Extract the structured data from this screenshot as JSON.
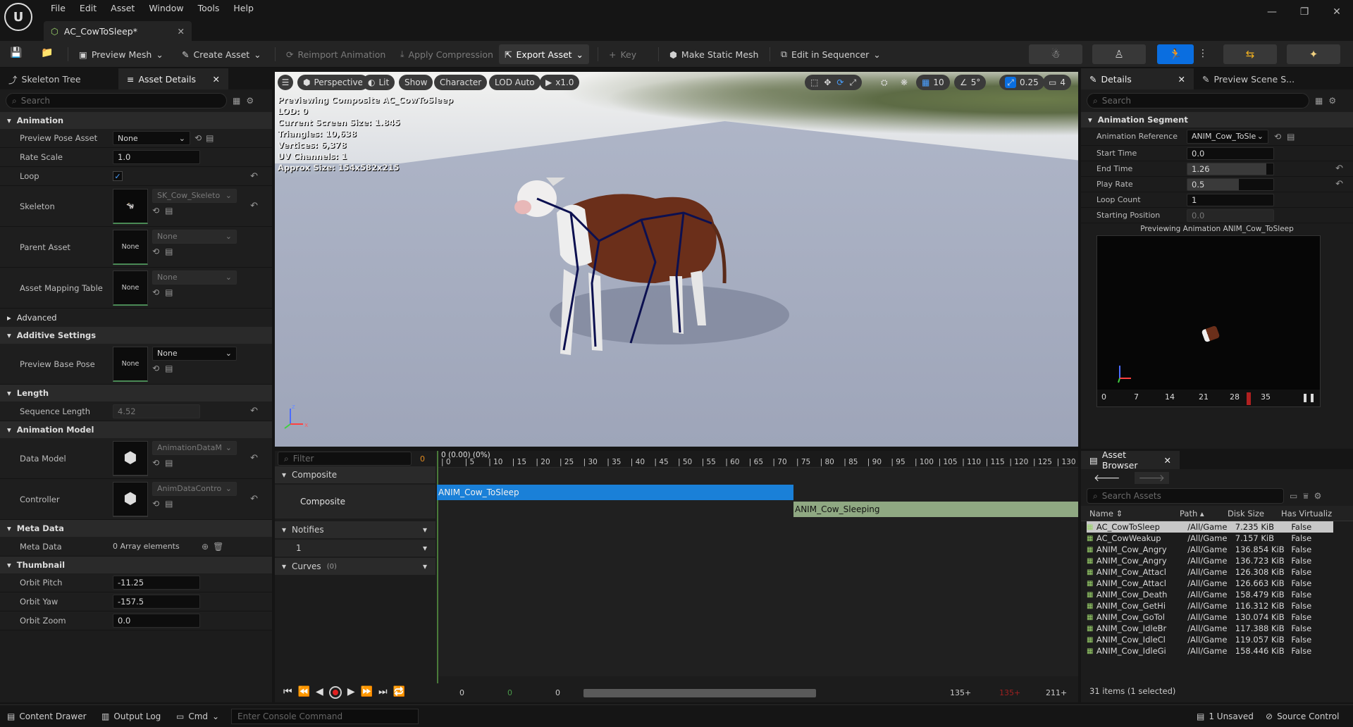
{
  "menu": [
    "File",
    "Edit",
    "Asset",
    "Window",
    "Tools",
    "Help"
  ],
  "doc_tab": {
    "title": "AC_CowToSleep*"
  },
  "toolbar": {
    "preview_mesh": "Preview Mesh",
    "create_asset": "Create Asset",
    "reimport": "Reimport Animation",
    "apply_compression": "Apply Compression",
    "export_asset": "Export Asset",
    "key": "Key",
    "make_static_mesh": "Make Static Mesh",
    "edit_in_sequencer": "Edit in Sequencer"
  },
  "left_tabs": {
    "skeleton_tree": "Skeleton Tree",
    "asset_details": "Asset Details"
  },
  "left_search_placeholder": "Search",
  "sections": {
    "animation": "Animation",
    "advanced": "Advanced",
    "additive": "Additive Settings",
    "length": "Length",
    "anim_model": "Animation Model",
    "meta": "Meta Data",
    "thumbnail": "Thumbnail"
  },
  "props": {
    "preview_pose_asset": {
      "label": "Preview Pose Asset",
      "value": "None"
    },
    "rate_scale": {
      "label": "Rate Scale",
      "value": "1.0"
    },
    "loop": {
      "label": "Loop"
    },
    "skeleton": {
      "label": "Skeleton",
      "value": "SK_Cow_Skeleto"
    },
    "parent_asset": {
      "label": "Parent Asset",
      "value": "None",
      "thumb": "None"
    },
    "asset_mapping": {
      "label": "Asset Mapping Table",
      "value": "None",
      "thumb": "None"
    },
    "preview_base_pose": {
      "label": "Preview Base Pose",
      "value": "None",
      "thumb": "None"
    },
    "sequence_length": {
      "label": "Sequence Length",
      "value": "4.52"
    },
    "data_model": {
      "label": "Data Model",
      "value": "AnimationDataM"
    },
    "controller": {
      "label": "Controller",
      "value": "AnimDataContro"
    },
    "meta_data": {
      "label": "Meta Data",
      "value": "0 Array elements"
    },
    "orbit_pitch": {
      "label": "Orbit Pitch",
      "value": "-11.25"
    },
    "orbit_yaw": {
      "label": "Orbit Yaw",
      "value": "-157.5"
    },
    "orbit_zoom": {
      "label": "Orbit Zoom",
      "value": "0.0"
    }
  },
  "viewport": {
    "perspective": "Perspective",
    "lit": "Lit",
    "show": "Show",
    "character": "Character",
    "lod": "LOD Auto",
    "speed": "x1.0",
    "grid_val": "10",
    "angle_val": "5°",
    "scale_val": "0.25",
    "cam_val": "4",
    "info": [
      "Previewing Composite AC_CowToSleep",
      "LOD: 0",
      "Current Screen Size: 1.845",
      "Triangles: 10,638",
      "Vertices: 6,378",
      "UV Channels: 1",
      "Approx Size: 154x582x215"
    ]
  },
  "timeline": {
    "filter_placeholder": "Filter",
    "frame_counter": "0",
    "head_label": "0 (0.00) (0%)",
    "composite_hdr": "Composite",
    "composite_row": "Composite",
    "notifies": "Notifies",
    "notify_track": "1",
    "curves": "Curves",
    "curves_count": "(0)",
    "segment1": "ANIM_Cow_ToSleep",
    "segment2": "ANIM_Cow_Sleeping",
    "ticks": [
      "0",
      "5",
      "10",
      "15",
      "20",
      "25",
      "30",
      "35",
      "40",
      "45",
      "50",
      "55",
      "60",
      "65",
      "70",
      "75",
      "80",
      "85",
      "90",
      "95",
      "100",
      "105",
      "110",
      "115",
      "120",
      "125",
      "130"
    ],
    "bottom": {
      "a": "0",
      "b": "0",
      "c": "0",
      "end1": "135+",
      "end2": "135+",
      "end3": "211+"
    }
  },
  "details": {
    "tab": "Details",
    "tab2": "Preview Scene S...",
    "search_placeholder": "Search",
    "section": "Animation Segment",
    "anim_ref": {
      "label": "Animation Reference",
      "value": "ANIM_Cow_ToSle"
    },
    "start_time": {
      "label": "Start Time",
      "value": "0.0"
    },
    "end_time": {
      "label": "End Time",
      "value": "1.26"
    },
    "play_rate": {
      "label": "Play Rate",
      "value": "0.5"
    },
    "loop_count": {
      "label": "Loop Count",
      "value": "1"
    },
    "starting_position": {
      "label": "Starting Position",
      "value": "0.0"
    },
    "preview_label": "Previewing Animation ANIM_Cow_ToSleep",
    "mini_ticks": [
      "0",
      "7",
      "14",
      "21",
      "28",
      "35"
    ]
  },
  "asset_browser": {
    "tab": "Asset Browser",
    "search_placeholder": "Search Assets",
    "cols": {
      "name": "Name",
      "path": "Path",
      "size": "Disk Size",
      "virt": "Has Virtualiz"
    },
    "rows": [
      {
        "name": "AC_CowToSleep",
        "path": "/All/Game",
        "size": "7.235 KiB",
        "virt": "False"
      },
      {
        "name": "AC_CowWeakup",
        "path": "/All/Game",
        "size": "7.157 KiB",
        "virt": "False"
      },
      {
        "name": "ANIM_Cow_Angry",
        "path": "/All/Game",
        "size": "136.854 KiB",
        "virt": "False"
      },
      {
        "name": "ANIM_Cow_Angry",
        "path": "/All/Game",
        "size": "136.723 KiB",
        "virt": "False"
      },
      {
        "name": "ANIM_Cow_Attacl",
        "path": "/All/Game",
        "size": "126.308 KiB",
        "virt": "False"
      },
      {
        "name": "ANIM_Cow_Attacl",
        "path": "/All/Game",
        "size": "126.663 KiB",
        "virt": "False"
      },
      {
        "name": "ANIM_Cow_Death",
        "path": "/All/Game",
        "size": "158.479 KiB",
        "virt": "False"
      },
      {
        "name": "ANIM_Cow_GetHi",
        "path": "/All/Game",
        "size": "116.312 KiB",
        "virt": "False"
      },
      {
        "name": "ANIM_Cow_GoTol",
        "path": "/All/Game",
        "size": "130.074 KiB",
        "virt": "False"
      },
      {
        "name": "ANIM_Cow_IdleBr",
        "path": "/All/Game",
        "size": "117.388 KiB",
        "virt": "False"
      },
      {
        "name": "ANIM_Cow_IdleCl",
        "path": "/All/Game",
        "size": "119.057 KiB",
        "virt": "False"
      },
      {
        "name": "ANIM_Cow_IdleGi",
        "path": "/All/Game",
        "size": "158.446 KiB",
        "virt": "False"
      }
    ],
    "status": "31 items (1 selected)"
  },
  "statusbar": {
    "content_drawer": "Content Drawer",
    "output_log": "Output Log",
    "cmd": "Cmd",
    "console_placeholder": "Enter Console Command",
    "unsaved": "1 Unsaved",
    "source_control": "Source Control"
  },
  "colors": {
    "accent": "#0a6ee0",
    "segment1": "#1a80d8",
    "segment2": "#8fa882"
  }
}
